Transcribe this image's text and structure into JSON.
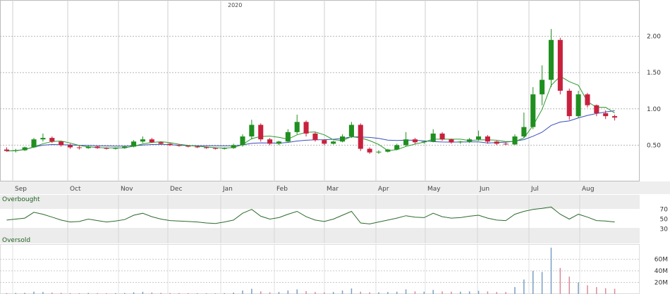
{
  "chart_data": {
    "type": "candlestick",
    "year_label": "2020",
    "price_axis": {
      "ticks": [
        0.5,
        1.0,
        1.5,
        2.0
      ],
      "tick_labels": [
        "0.50",
        "1.00",
        "1.50",
        "2.00"
      ],
      "ylim": [
        0.0,
        2.5
      ]
    },
    "months": [
      "Sep",
      "Oct",
      "Nov",
      "Dec",
      "Jan",
      "Feb",
      "Mar",
      "Apr",
      "May",
      "Jun",
      "Jul",
      "Aug"
    ],
    "candles": [
      {
        "o": 0.44,
        "h": 0.47,
        "l": 0.41,
        "c": 0.42
      },
      {
        "o": 0.42,
        "h": 0.45,
        "l": 0.4,
        "c": 0.43
      },
      {
        "o": 0.43,
        "h": 0.48,
        "l": 0.42,
        "c": 0.47
      },
      {
        "o": 0.47,
        "h": 0.6,
        "l": 0.46,
        "c": 0.58
      },
      {
        "o": 0.58,
        "h": 0.66,
        "l": 0.55,
        "c": 0.6
      },
      {
        "o": 0.6,
        "h": 0.62,
        "l": 0.53,
        "c": 0.55
      },
      {
        "o": 0.55,
        "h": 0.56,
        "l": 0.48,
        "c": 0.5
      },
      {
        "o": 0.5,
        "h": 0.52,
        "l": 0.45,
        "c": 0.47
      },
      {
        "o": 0.47,
        "h": 0.49,
        "l": 0.44,
        "c": 0.46
      },
      {
        "o": 0.46,
        "h": 0.5,
        "l": 0.45,
        "c": 0.48
      },
      {
        "o": 0.48,
        "h": 0.49,
        "l": 0.45,
        "c": 0.46
      },
      {
        "o": 0.46,
        "h": 0.47,
        "l": 0.44,
        "c": 0.45
      },
      {
        "o": 0.45,
        "h": 0.47,
        "l": 0.44,
        "c": 0.46
      },
      {
        "o": 0.46,
        "h": 0.49,
        "l": 0.45,
        "c": 0.48
      },
      {
        "o": 0.48,
        "h": 0.57,
        "l": 0.47,
        "c": 0.55
      },
      {
        "o": 0.55,
        "h": 0.62,
        "l": 0.53,
        "c": 0.58
      },
      {
        "o": 0.58,
        "h": 0.6,
        "l": 0.53,
        "c": 0.54
      },
      {
        "o": 0.54,
        "h": 0.55,
        "l": 0.51,
        "c": 0.52
      },
      {
        "o": 0.52,
        "h": 0.53,
        "l": 0.49,
        "c": 0.5
      },
      {
        "o": 0.5,
        "h": 0.51,
        "l": 0.48,
        "c": 0.49
      },
      {
        "o": 0.49,
        "h": 0.5,
        "l": 0.47,
        "c": 0.48
      },
      {
        "o": 0.48,
        "h": 0.49,
        "l": 0.46,
        "c": 0.47
      },
      {
        "o": 0.47,
        "h": 0.48,
        "l": 0.45,
        "c": 0.46
      },
      {
        "o": 0.46,
        "h": 0.47,
        "l": 0.44,
        "c": 0.45
      },
      {
        "o": 0.45,
        "h": 0.47,
        "l": 0.44,
        "c": 0.46
      },
      {
        "o": 0.46,
        "h": 0.52,
        "l": 0.45,
        "c": 0.5
      },
      {
        "o": 0.5,
        "h": 0.65,
        "l": 0.48,
        "c": 0.62
      },
      {
        "o": 0.62,
        "h": 0.85,
        "l": 0.58,
        "c": 0.78
      },
      {
        "o": 0.78,
        "h": 0.8,
        "l": 0.55,
        "c": 0.58
      },
      {
        "o": 0.58,
        "h": 0.6,
        "l": 0.5,
        "c": 0.52
      },
      {
        "o": 0.52,
        "h": 0.56,
        "l": 0.5,
        "c": 0.55
      },
      {
        "o": 0.55,
        "h": 0.72,
        "l": 0.54,
        "c": 0.68
      },
      {
        "o": 0.68,
        "h": 0.92,
        "l": 0.65,
        "c": 0.82
      },
      {
        "o": 0.82,
        "h": 0.84,
        "l": 0.62,
        "c": 0.66
      },
      {
        "o": 0.66,
        "h": 0.68,
        "l": 0.55,
        "c": 0.57
      },
      {
        "o": 0.57,
        "h": 0.58,
        "l": 0.5,
        "c": 0.52
      },
      {
        "o": 0.52,
        "h": 0.56,
        "l": 0.51,
        "c": 0.55
      },
      {
        "o": 0.55,
        "h": 0.65,
        "l": 0.54,
        "c": 0.62
      },
      {
        "o": 0.62,
        "h": 0.82,
        "l": 0.6,
        "c": 0.78
      },
      {
        "o": 0.78,
        "h": 0.8,
        "l": 0.42,
        "c": 0.45
      },
      {
        "o": 0.45,
        "h": 0.47,
        "l": 0.38,
        "c": 0.4
      },
      {
        "o": 0.4,
        "h": 0.43,
        "l": 0.38,
        "c": 0.41
      },
      {
        "o": 0.41,
        "h": 0.45,
        "l": 0.4,
        "c": 0.44
      },
      {
        "o": 0.44,
        "h": 0.52,
        "l": 0.43,
        "c": 0.5
      },
      {
        "o": 0.5,
        "h": 0.68,
        "l": 0.48,
        "c": 0.58
      },
      {
        "o": 0.58,
        "h": 0.6,
        "l": 0.52,
        "c": 0.54
      },
      {
        "o": 0.54,
        "h": 0.56,
        "l": 0.52,
        "c": 0.55
      },
      {
        "o": 0.55,
        "h": 0.72,
        "l": 0.54,
        "c": 0.66
      },
      {
        "o": 0.66,
        "h": 0.68,
        "l": 0.56,
        "c": 0.58
      },
      {
        "o": 0.58,
        "h": 0.59,
        "l": 0.52,
        "c": 0.54
      },
      {
        "o": 0.54,
        "h": 0.56,
        "l": 0.52,
        "c": 0.55
      },
      {
        "o": 0.55,
        "h": 0.6,
        "l": 0.53,
        "c": 0.58
      },
      {
        "o": 0.58,
        "h": 0.7,
        "l": 0.56,
        "c": 0.62
      },
      {
        "o": 0.62,
        "h": 0.64,
        "l": 0.52,
        "c": 0.55
      },
      {
        "o": 0.55,
        "h": 0.56,
        "l": 0.5,
        "c": 0.52
      },
      {
        "o": 0.52,
        "h": 0.54,
        "l": 0.5,
        "c": 0.51
      },
      {
        "o": 0.51,
        "h": 0.65,
        "l": 0.5,
        "c": 0.62
      },
      {
        "o": 0.62,
        "h": 0.95,
        "l": 0.6,
        "c": 0.75
      },
      {
        "o": 0.75,
        "h": 1.3,
        "l": 0.72,
        "c": 1.2
      },
      {
        "o": 1.2,
        "h": 1.6,
        "l": 1.05,
        "c": 1.4
      },
      {
        "o": 1.4,
        "h": 2.1,
        "l": 1.3,
        "c": 1.95
      },
      {
        "o": 1.95,
        "h": 1.98,
        "l": 1.2,
        "c": 1.25
      },
      {
        "o": 1.25,
        "h": 1.28,
        "l": 0.85,
        "c": 0.9
      },
      {
        "o": 0.9,
        "h": 1.25,
        "l": 0.88,
        "c": 1.2
      },
      {
        "o": 1.2,
        "h": 1.22,
        "l": 1.02,
        "c": 1.05
      },
      {
        "o": 1.05,
        "h": 1.06,
        "l": 0.9,
        "c": 0.94
      },
      {
        "o": 0.94,
        "h": 0.98,
        "l": 0.86,
        "c": 0.9
      },
      {
        "o": 0.9,
        "h": 0.92,
        "l": 0.84,
        "c": 0.88
      }
    ],
    "rsi": {
      "labels": {
        "overbought": "Overbought",
        "oversold": "Oversold"
      },
      "ticks": [
        70,
        50,
        30
      ],
      "ylim": [
        0,
        100
      ],
      "values": [
        48,
        50,
        52,
        64,
        60,
        54,
        48,
        44,
        45,
        50,
        47,
        44,
        46,
        49,
        58,
        62,
        55,
        50,
        47,
        46,
        45,
        44,
        42,
        41,
        44,
        48,
        62,
        70,
        56,
        50,
        53,
        60,
        66,
        55,
        48,
        45,
        50,
        58,
        66,
        42,
        40,
        44,
        48,
        52,
        57,
        54,
        53,
        62,
        55,
        52,
        53,
        56,
        58,
        52,
        48,
        47,
        60,
        66,
        70,
        72,
        75,
        60,
        50,
        60,
        54,
        47,
        46,
        44
      ]
    },
    "volume": {
      "ticks": [
        20000000,
        40000000,
        60000000
      ],
      "tick_labels": [
        "20M",
        "40M",
        "60M"
      ],
      "ylim": [
        0,
        85000000
      ],
      "values": [
        1500000.0,
        1800000.0,
        2000000.0,
        4000000.0,
        3500000.0,
        2500000.0,
        2000000.0,
        1600000.0,
        1500000.0,
        1800000.0,
        1500000.0,
        1400000.0,
        1500000.0,
        1800000.0,
        3000000.0,
        3800000.0,
        2600000.0,
        2000000.0,
        1800000.0,
        1600000.0,
        1500000.0,
        1500000.0,
        1400000.0,
        1300000.0,
        1500000.0,
        2500000.0,
        6000000.0,
        9000000.0,
        4500000.0,
        3000000.0,
        3500000.0,
        6000000.0,
        8000000.0,
        5000000.0,
        3500000.0,
        3000000.0,
        3500000.0,
        6000000.0,
        9500000.0,
        4000000.0,
        3000000.0,
        3000000.0,
        3500000.0,
        4000000.0,
        8000000.0,
        4500000.0,
        4000000.0,
        7000000.0,
        4500000.0,
        4000000.0,
        4000000.0,
        4500000.0,
        5500000.0,
        4500000.0,
        3500000.0,
        3500000.0,
        12000000.0,
        25000000.0,
        40000000.0,
        38000000.0,
        80000000.0,
        45000000.0,
        30000000.0,
        20000000.0,
        15000000.0,
        12000000.0,
        10000000.0,
        9000000.0
      ]
    }
  }
}
